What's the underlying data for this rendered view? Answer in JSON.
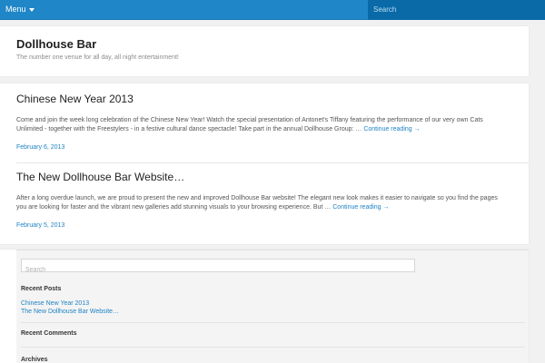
{
  "topbar": {
    "menu_label": "Menu",
    "search_placeholder": "Search"
  },
  "header": {
    "title": "Dollhouse Bar",
    "description": "The number one venue for all day, all night entertainment!"
  },
  "posts": [
    {
      "title": "Chinese New Year 2013",
      "excerpt": "Come and join the week long celebration of the Chinese New Year! Watch the special presentation of Antonet's Tiffany featuring the performance of our very own Cats Unlimited - together with the Freestylers - in a festive cultural dance spectacle! Take part in the annual Dollhouse Group: … ",
      "more": "Continue reading →",
      "date": "February 6, 2013"
    },
    {
      "title": "The New Dollhouse Bar Website…",
      "excerpt": "After a long overdue launch, we are proud to present the new and improved Dollhouse Bar website! The elegant new look makes it easier to navigate so you find the pages you are looking for faster and the vibrant new galleries add stunning visuals to your browsing experience.    But … ",
      "more": "Continue reading →",
      "date": "February 5, 2013"
    }
  ],
  "widgets": {
    "search_placeholder": "Search",
    "recent_posts_title": "Recent Posts",
    "recent_posts": [
      "Chinese New Year 2013",
      "The New Dollhouse Bar Website…"
    ],
    "recent_comments_title": "Recent Comments",
    "archives_title": "Archives"
  },
  "colors": {
    "topbar": "#1f86c8",
    "search_bg": "#0a6aa8",
    "link": "#1e83c4"
  }
}
